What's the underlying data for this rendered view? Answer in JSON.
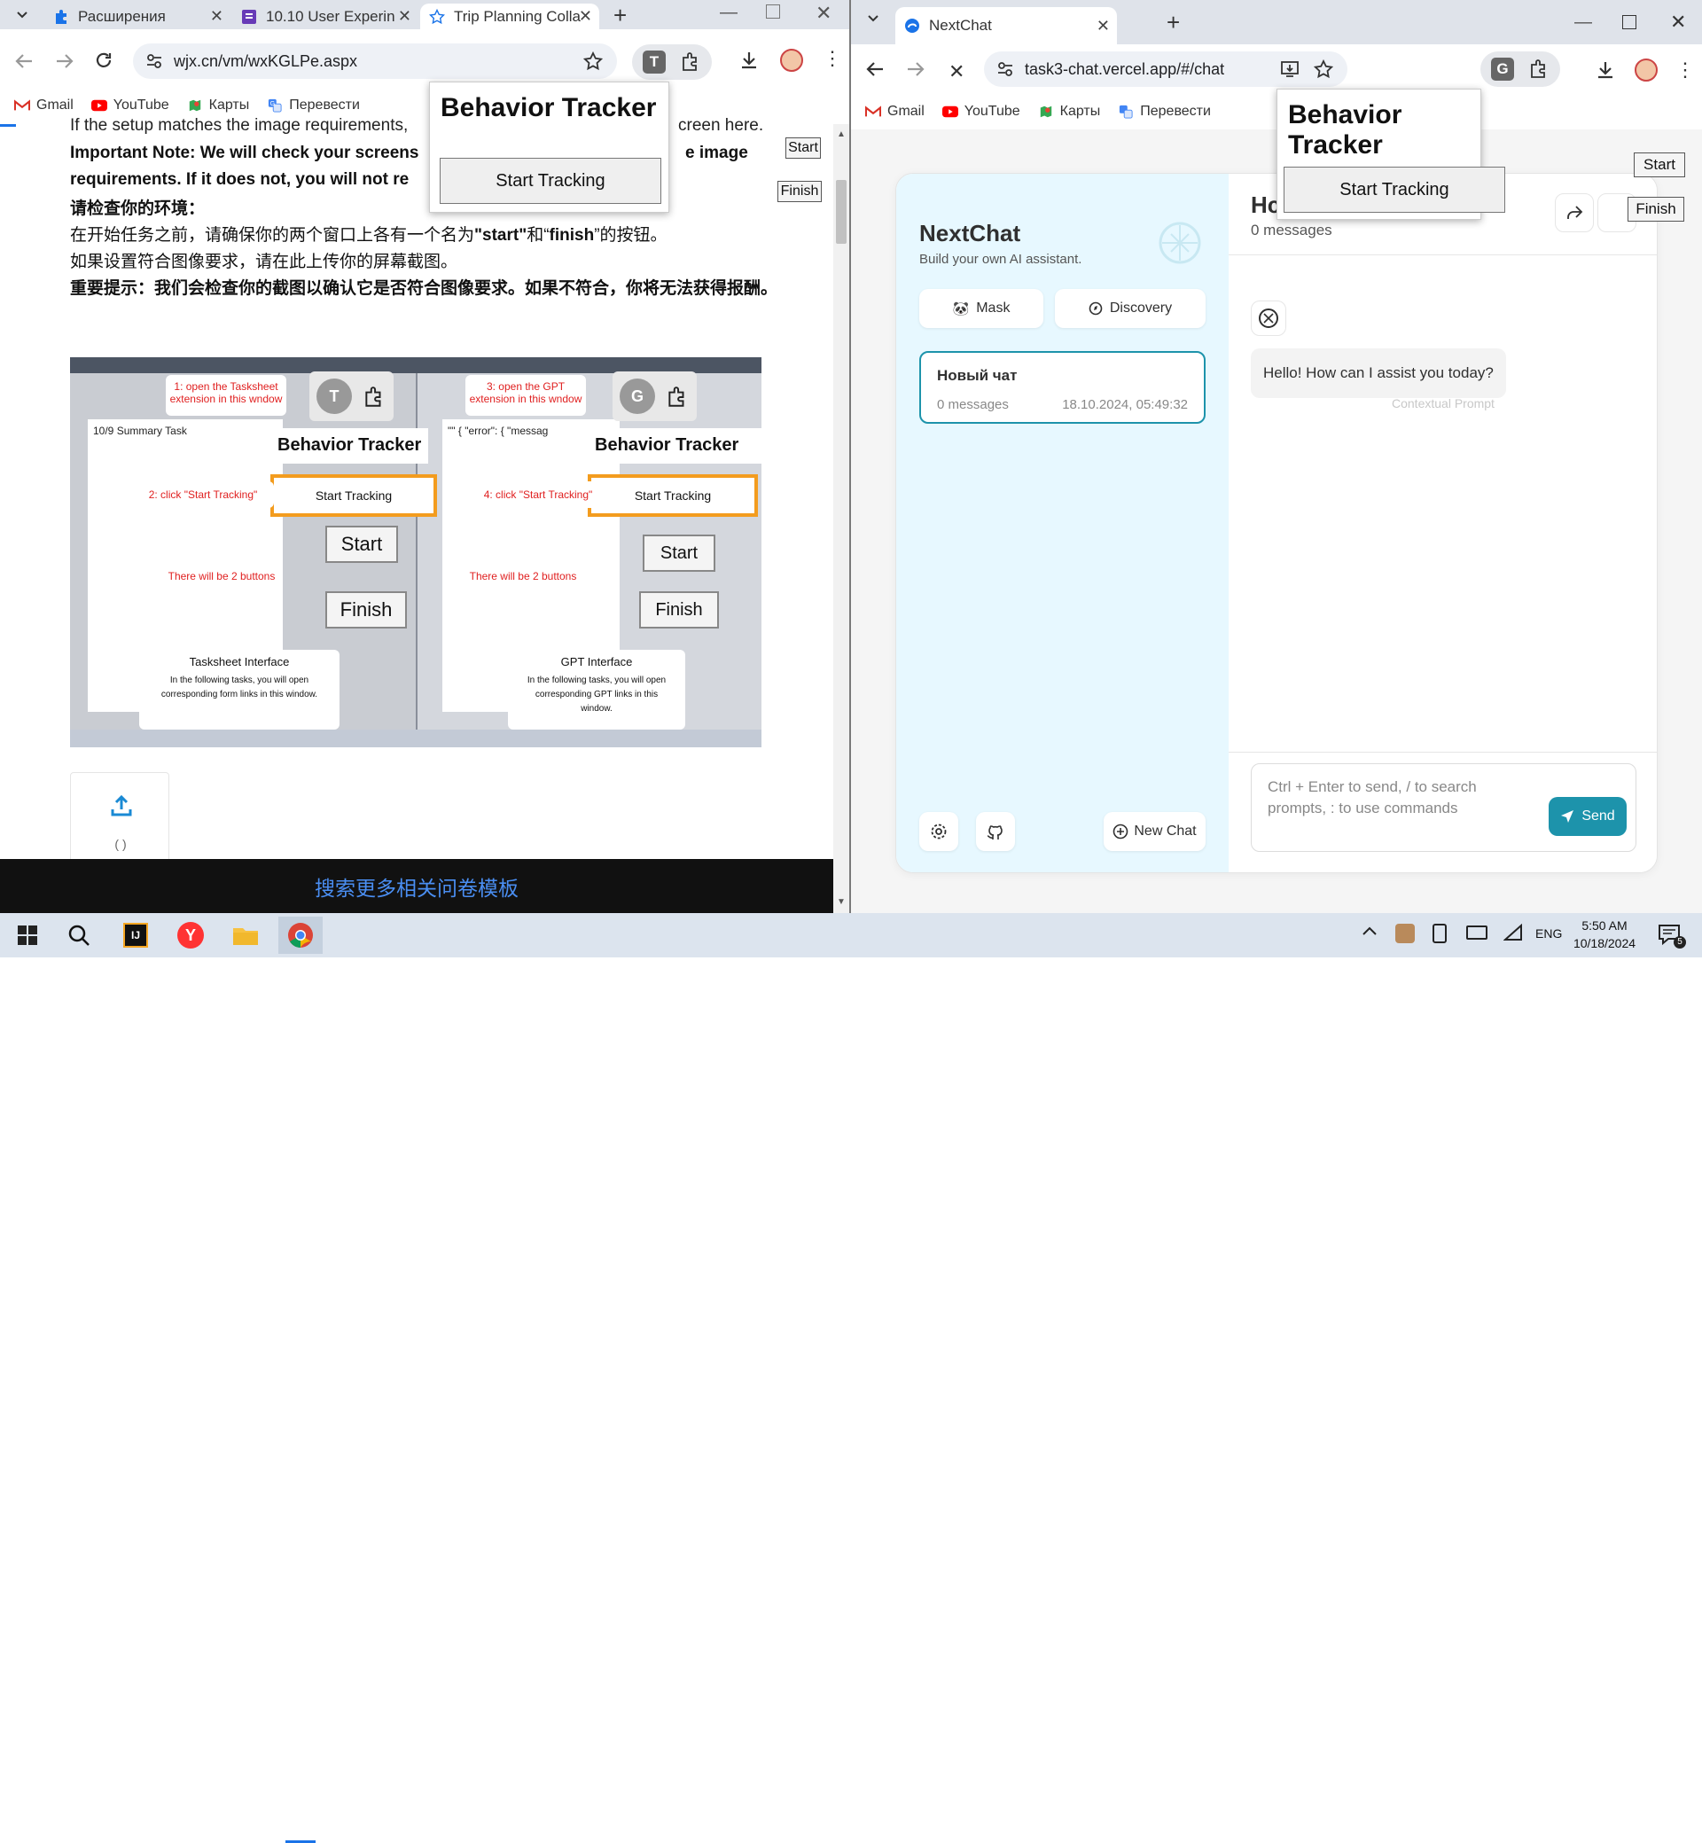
{
  "left_browser": {
    "tabs": [
      {
        "label": "Расширения"
      },
      {
        "label": "10.10 User Experin"
      },
      {
        "label": "Trip Planning Colla"
      }
    ],
    "new_tab_label": "+",
    "url": "wjx.cn/vm/wxKGLPe.aspx",
    "ext_letter": "T",
    "bookmarks": [
      "Gmail",
      "YouTube",
      "Карты",
      "Перевести"
    ],
    "popup": {
      "title": "Behavior Tracker",
      "button": "Start Tracking"
    },
    "page_start": "Start",
    "page_finish": "Finish",
    "content": {
      "line1": "If the setup matches the image requirements,",
      "line1_tail": "creen here.",
      "note_a": "Important Note: We will check your screens",
      "note_a_tail": "e image",
      "note_b": "requirements. If it does not, you will not re",
      "cn_heading": "请检查你的环境：",
      "cn_line1_pre": "在开始任务之前，请确保你的两个窗口上各有一个名为",
      "cn_start": "\"start\"",
      "cn_and": "和“",
      "cn_finish": "finish",
      "cn_line1_post": "”的按钮。",
      "cn_line2": "如果设置符合图像要求，请在此上传你的屏幕截图。",
      "cn_note": "重要提示：我们会检查你的截图以确认它是否符合图像要求。如果不符合，你将无法获得报酬。",
      "upload_caption": "( )"
    },
    "example": {
      "callout1": "1: open the Tasksheet extension in this wndow",
      "callout2": "2: click \"Start Tracking\"",
      "callout3": "3: open the GPT extension in this wndow",
      "callout4": "4: click \"Start Tracking\"",
      "two_buttons": "There will be 2 buttons",
      "bt_title": "Behavior Tracker",
      "bt_button": "Start Tracking",
      "start": "Start",
      "finish": "Finish",
      "ext_t": "T",
      "ext_g": "G",
      "task_title": "10/9 Summary Task",
      "task_box_title": "Tasksheet Interface",
      "task_box_body": "In the following tasks, you will open corresponding form links in this window.",
      "gpt_box_title": "GPT Interface",
      "gpt_box_body": "In the following tasks, you will open corresponding GPT links in this window.",
      "gpt_error": "\"\" { \"error\": { \"messag"
    },
    "banner": "搜索更多相关问卷模板"
  },
  "right_browser": {
    "tab": "NextChat",
    "url": "task3-chat.vercel.app/#/chat",
    "ext_letter": "G",
    "bookmarks": [
      "Gmail",
      "YouTube",
      "Карты",
      "Перевести"
    ],
    "popup": {
      "title": "Behavior Tracker",
      "button": "Start Tracking"
    },
    "page_start": "Start",
    "page_finish": "Finish",
    "app": {
      "title": "NextChat",
      "subtitle": "Build your own AI assistant.",
      "mask": "Mask",
      "discovery": "Discovery",
      "chat_item": {
        "title": "Новый чат",
        "count": "0 messages",
        "date": "18.10.2024, 05:49:32"
      },
      "new_chat": "New Chat",
      "header_title": "Нс",
      "header_count": "0 messages",
      "bot_message": "Hello! How can I assist you today?",
      "context_prompt": "Contextual Prompt",
      "input_placeholder": "Ctrl + Enter to send, / to search prompts, : to use commands",
      "send": "Send"
    }
  },
  "taskbar": {
    "lang": "ENG",
    "time": "5:50 AM",
    "date": "10/18/2024"
  },
  "colors": {
    "accent": "#1d93ab",
    "chrome_bar": "#dfe3ea",
    "nc_sidebar": "#e7f8ff"
  }
}
